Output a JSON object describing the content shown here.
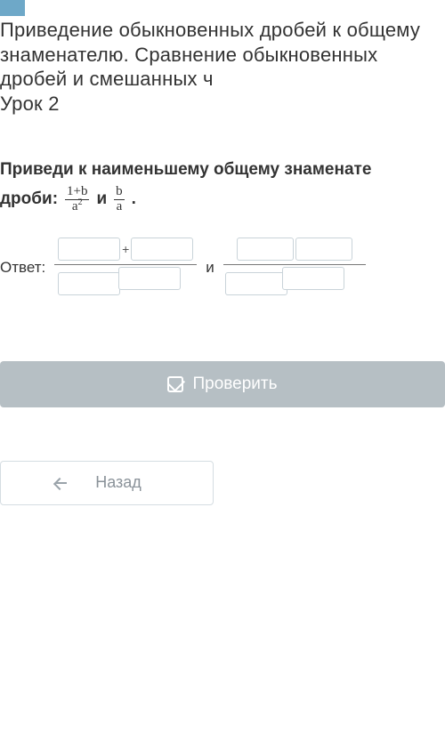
{
  "heading": "Приведение обыкновенных дробей к общему знаменателю. Сравнение обыкновенных дробей и смешанных ч\nУрок 2",
  "task": {
    "line1": "Приведи к наименьшему общему знаменате",
    "prefix": "дроби:",
    "frac1": {
      "num": "1+b",
      "den_base": "a",
      "den_exp": "2"
    },
    "conj": "и",
    "frac2": {
      "num": "b",
      "den": "a"
    },
    "suffix": "."
  },
  "answer": {
    "label": "Ответ:",
    "plus": "+",
    "conj": "и"
  },
  "buttons": {
    "check": "Проверить",
    "back": "Назад"
  }
}
